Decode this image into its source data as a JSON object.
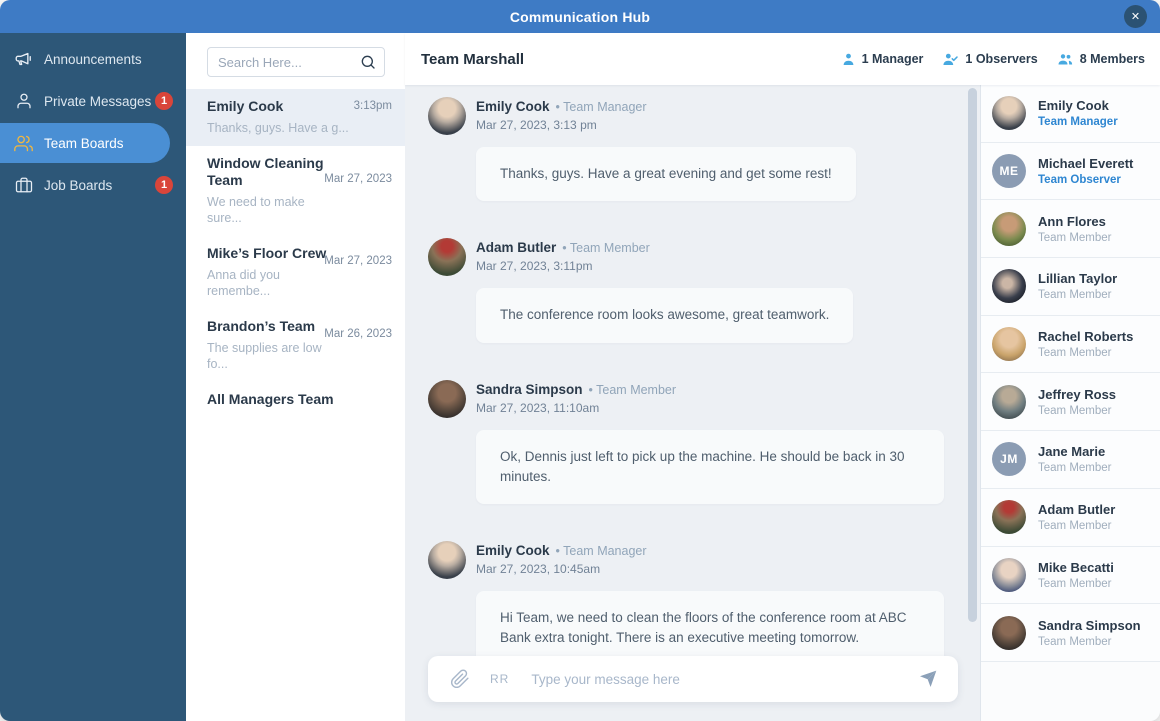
{
  "titlebar": {
    "title": "Communication Hub",
    "close_glyph": "✕"
  },
  "sidebar": {
    "items": [
      {
        "label": "Announcements",
        "badge": ""
      },
      {
        "label": "Private Messages",
        "badge": "1"
      },
      {
        "label": "Team Boards",
        "badge": ""
      },
      {
        "label": "Job Boards",
        "badge": "1"
      }
    ]
  },
  "conversations": {
    "search_placeholder": "Search Here...",
    "items": [
      {
        "title": "Emily Cook",
        "preview": "Thanks, guys. Have a g...",
        "time": "3:13pm"
      },
      {
        "title": "Window Cleaning\nTeam",
        "preview": "We need to make\nsure...",
        "time": "Mar 27, 2023"
      },
      {
        "title": "Mike’s Floor Crew",
        "preview": "Anna did you\nremembe...",
        "time": "Mar 27, 2023"
      },
      {
        "title": "Brandon’s Team",
        "preview": "The supplies are low\nfo...",
        "time": "Mar 26, 2023"
      },
      {
        "title": "All Managers Team",
        "preview": "",
        "time": ""
      }
    ]
  },
  "chat": {
    "title": "Team Marshall",
    "stats": [
      {
        "label": "1 Manager"
      },
      {
        "label": "1 Observers"
      },
      {
        "label": "8 Members"
      }
    ],
    "messages": [
      {
        "name": "Emily Cook",
        "role": "Team Manager",
        "date": "Mar 27, 2023, 3:13 pm",
        "text": "Thanks, guys. Have a great evening and get some rest!"
      },
      {
        "name": "Adam Butler",
        "role": "Team Member",
        "date": "Mar 27, 2023, 3:11pm",
        "text": "The conference room looks awesome, great teamwork."
      },
      {
        "name": "Sandra Simpson",
        "role": "Team Member",
        "date": "Mar 27, 2023, 11:10am",
        "text": "Ok, Dennis just left to pick up the machine. He should be back in 30 minutes."
      },
      {
        "name": "Emily Cook",
        "role": "Team Manager",
        "date": "Mar 27, 2023, 10:45am",
        "text": "Hi Team, we need to clean the floors of the conference room at ABC Bank extra tonight. There is an executive meeting tomorrow."
      }
    ],
    "input": {
      "format_label": "RR",
      "placeholder": "Type your message here"
    }
  },
  "members": {
    "items": [
      {
        "name": "Emily Cook",
        "role": "Team Manager",
        "initials": ""
      },
      {
        "name": "Michael Everett",
        "role": "Team Observer",
        "initials": "ME"
      },
      {
        "name": "Ann Flores",
        "role": "Team Member",
        "initials": ""
      },
      {
        "name": "Lillian Taylor",
        "role": "Team Member",
        "initials": ""
      },
      {
        "name": "Rachel Roberts",
        "role": "Team Member",
        "initials": ""
      },
      {
        "name": "Jeffrey Ross",
        "role": "Team Member",
        "initials": ""
      },
      {
        "name": "Jane Marie",
        "role": "Team Member",
        "initials": "JM"
      },
      {
        "name": "Adam Butler",
        "role": "Team Member",
        "initials": ""
      },
      {
        "name": "Mike Becatti",
        "role": "Team Member",
        "initials": ""
      },
      {
        "name": "Sandra Simpson",
        "role": "Team Member",
        "initials": ""
      }
    ]
  },
  "avatars": {
    "emily": "background:radial-gradient(circle at 50% 30%, #e6d0ba 26%, #b8aca1 42%, #383f49 75%)",
    "michael": "background:#8b9cb3",
    "ann": "background:radial-gradient(circle at 50% 35%, #c79b77 26%, #7a8a4e 58%, #4c5e33 85%)",
    "lillian": "background:radial-gradient(circle at 45% 42%, #cbb6a6 18%, #3a3f4c 55%, #141820 85%)",
    "rachel": "background:radial-gradient(circle at 50% 35%, #e6c5a1 30%, #c9a36a 60%, #8a6f4e 88%)",
    "jeffrey": "background:radial-gradient(circle at 50% 32%, #b8aa96 24%, #6f7d80 55%, #3f4a4e 85%)",
    "jane": "background:#8b9cb3",
    "adam": "background:radial-gradient(circle at 50% 22%, #b33a35 16%, #8a7257 42%, #3c4a35 78%)",
    "mike": "background:radial-gradient(circle at 50% 35%, #e8d3c3 28%, #8a8e99 58%, #2f3f6e 88%)",
    "sandra": "background:radial-gradient(circle at 50% 34%, #8a6a55 28%, #5a4a3e 55%, #2e2a28 82%)"
  },
  "colors": {
    "titlebar_blue": "#3e7bc5",
    "sidebar_blue": "#2d5778",
    "active_item_blue": "#4a8fd4",
    "badge_red": "#d9453a",
    "role_accent_blue": "#2e86d1",
    "stat_icon_blue": "#47a9e0",
    "chat_background": "#edf0f4"
  }
}
